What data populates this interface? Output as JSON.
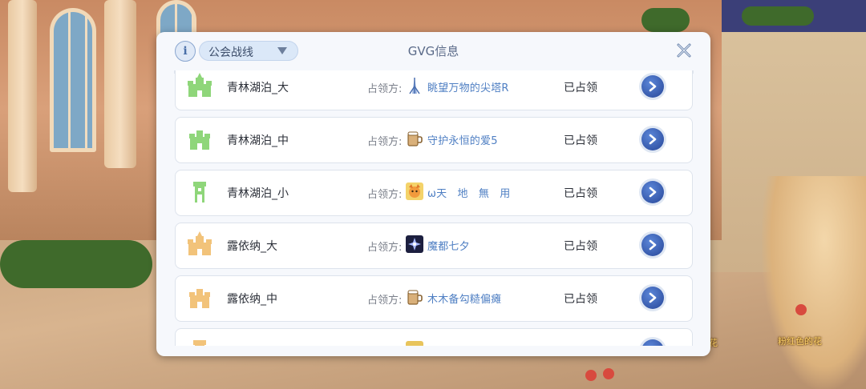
{
  "header": {
    "info_icon": "info-icon",
    "dropdown_value": "公会战线",
    "title": "GVG信息",
    "close_icon": "close-x-icon"
  },
  "list": {
    "occupier_label": "占领方:",
    "rows": [
      {
        "castle_name": "青林湖泊_大",
        "castle_color": "#8fd67a",
        "castle_icon": "castle-large-icon",
        "guild_icon": "spire-icon",
        "guild_name": "眺望万物的尖塔R",
        "status": "已占领"
      },
      {
        "castle_name": "青林湖泊_中",
        "castle_color": "#8fd67a",
        "castle_icon": "castle-medium-icon",
        "guild_icon": "mug-icon",
        "guild_name": "守护永恒的爱5",
        "status": "已占领"
      },
      {
        "castle_name": "青林湖泊_小",
        "castle_color": "#8fd67a",
        "castle_icon": "castle-small-icon",
        "guild_icon": "fox-avatar-icon",
        "guild_name": "ω天　地　無　用",
        "status": "已占领"
      },
      {
        "castle_name": "露依纳_大",
        "castle_color": "#f2c37a",
        "castle_icon": "castle-large-icon",
        "guild_icon": "dark-emblem-icon",
        "guild_name": "魔都七夕",
        "status": "已占领"
      },
      {
        "castle_name": "露依纳_中",
        "castle_color": "#f2c37a",
        "castle_icon": "castle-medium-icon",
        "guild_icon": "mug-icon",
        "guild_name": "木木备勾糙偏瘫",
        "status": "已占领"
      },
      {
        "castle_name": "",
        "castle_color": "#f2c37a",
        "castle_icon": "castle-small-icon",
        "guild_icon": "partial-icon",
        "guild_name": "",
        "status": ""
      }
    ]
  },
  "scene": {
    "label_1": "花",
    "label_2": "粉红色的花"
  },
  "colors": {
    "accent": "#3456a8",
    "guild_link": "#4f7fc3",
    "panel_bg": "#f6f8fc"
  }
}
